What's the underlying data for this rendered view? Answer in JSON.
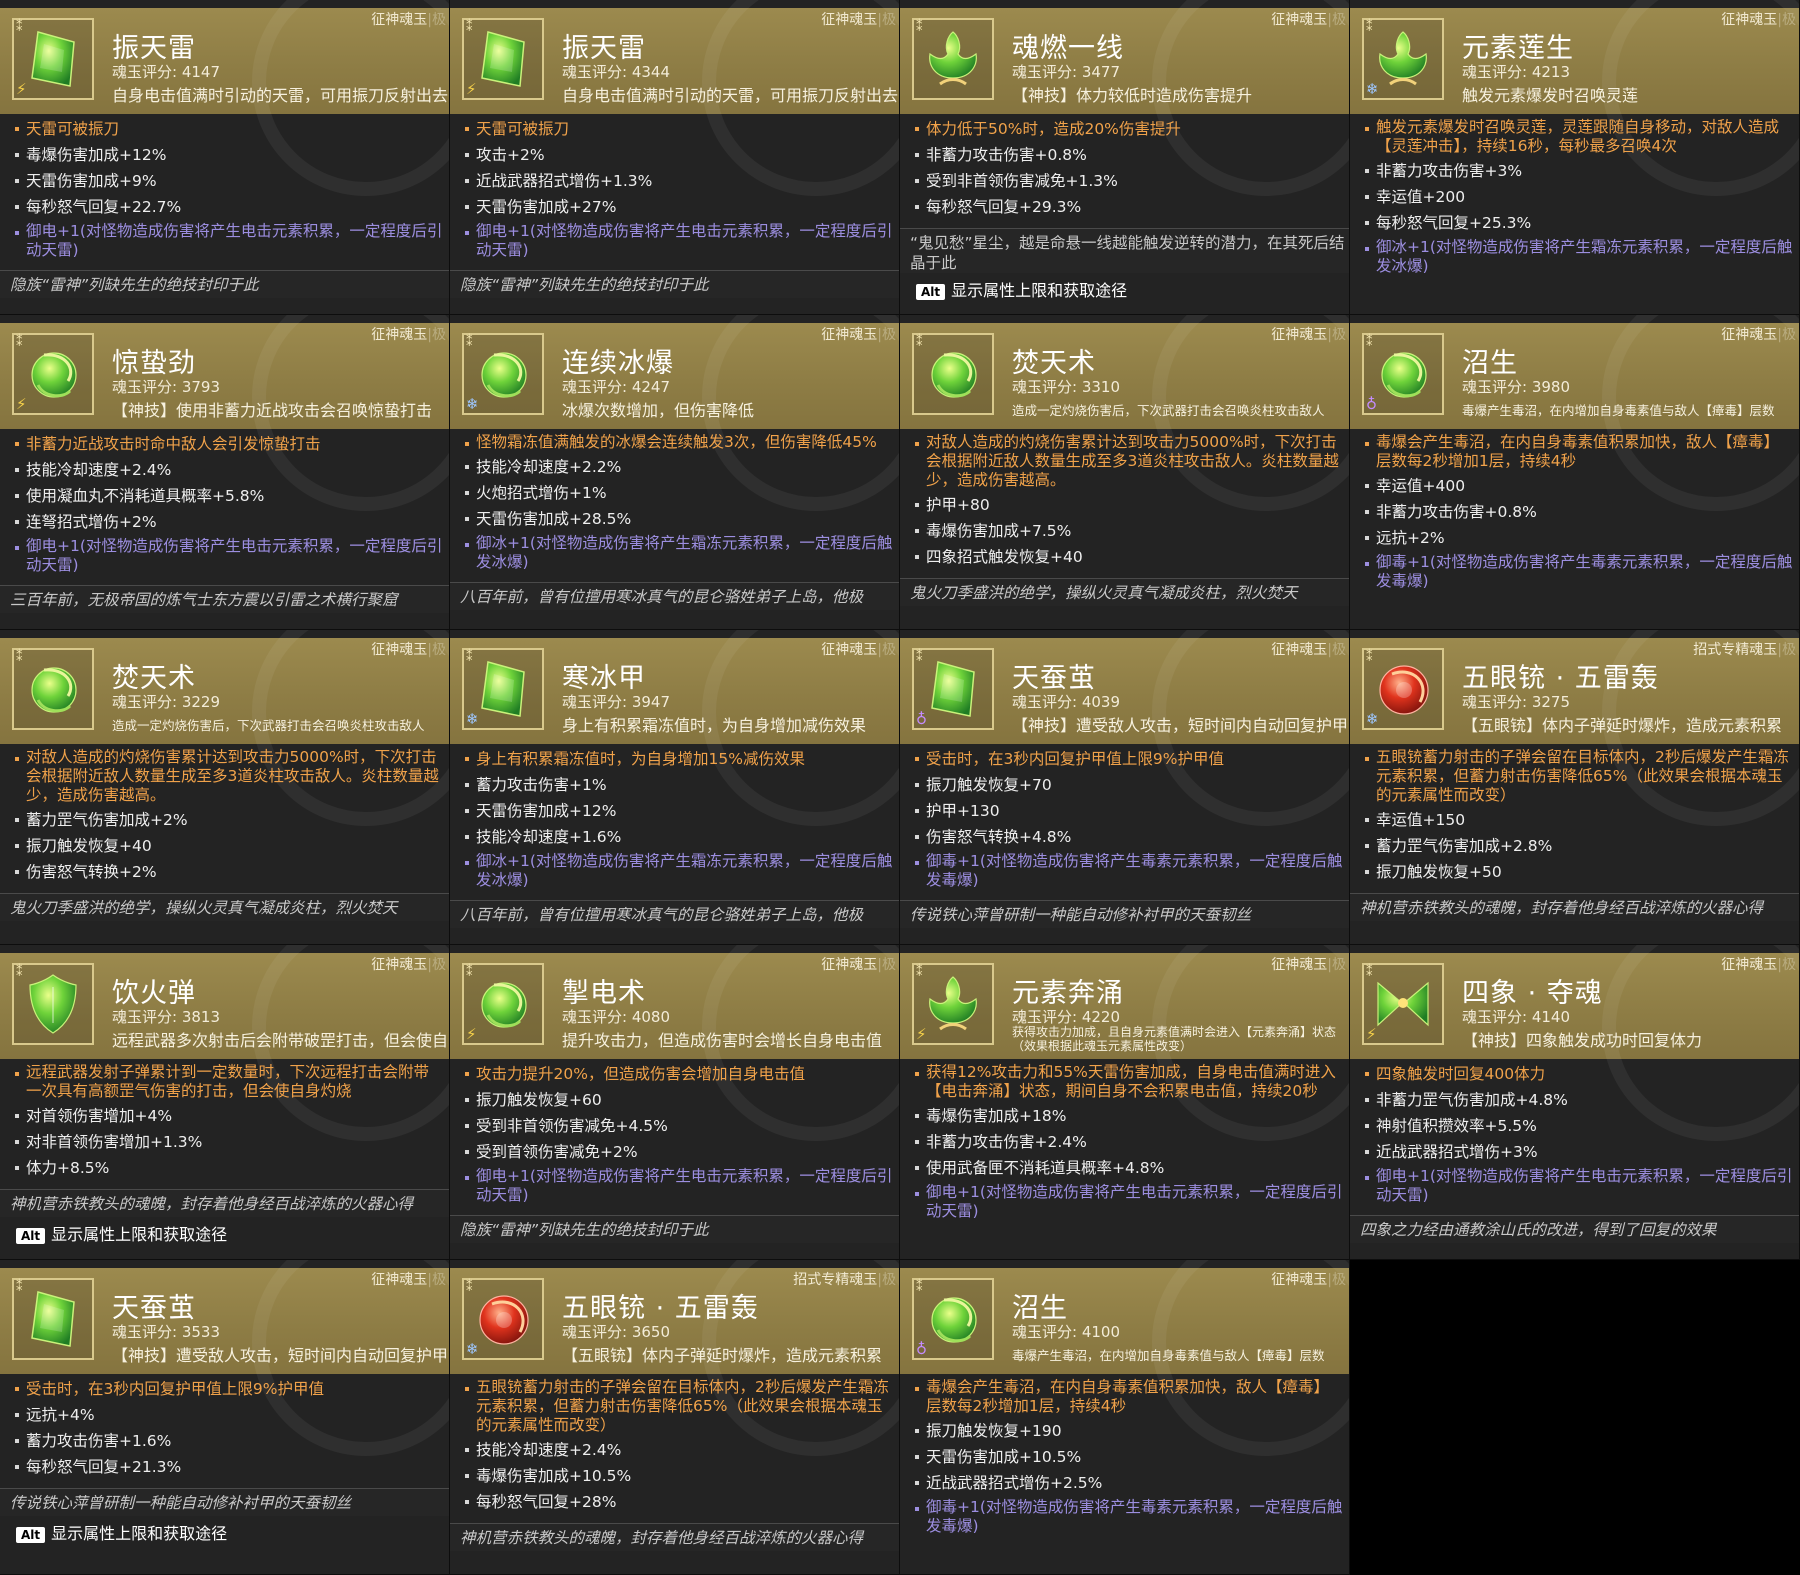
{
  "cards": [
    {
      "title": "振天雷",
      "tag": "征神魂玉",
      "grade": "极",
      "score": "魂玉评分: 4147",
      "desc": "自身电击值满时引动的天雷，可用振刀反射出去",
      "icon": "green-jade-icon",
      "element": "lightning-icon",
      "main": "天雷可被振刀",
      "attrs": [
        "毒爆伤害加成+12%",
        "天雷伤害加成+9%",
        "每秒怒气回复+22.7%"
      ],
      "elem": "御电+1(对怪物造成伤害将产生电击元素积累，一定程度后引动天雷)",
      "flavor": "隐族“雷神”列缺先生的绝技封印于此"
    },
    {
      "title": "振天雷",
      "tag": "征神魂玉",
      "grade": "极",
      "score": "魂玉评分: 4344",
      "desc": "自身电击值满时引动的天雷，可用振刀反射出去",
      "icon": "green-jade-icon",
      "element": "lightning-icon",
      "main": "天雷可被振刀",
      "attrs": [
        "攻击+2%",
        "近战武器招式增伤+1.3%",
        "天雷伤害加成+27%"
      ],
      "elem": "御电+1(对怪物造成伤害将产生电击元素积累，一定程度后引动天雷)",
      "flavor": "隐族“雷神”列缺先生的绝技封印于此"
    },
    {
      "title": "魂燃一线",
      "tag": "征神魂玉",
      "grade": "极",
      "score": "魂玉评分: 3477",
      "desc": "【神技】体力较低时造成伤害提升",
      "icon": "lotus-jade-icon",
      "element": "",
      "main": "体力低于50%时，造成20%伤害提升",
      "attrs": [
        "非蓄力攻击伤害+0.8%",
        "受到非首领伤害减免+1.3%",
        "每秒怒气回复+29.3%"
      ],
      "elem": "",
      "flavor": "“鬼见愁”星尘，越是命悬一线越能触发逆转的潜力，在其死后结晶于此",
      "alt": "显示属性上限和获取途径"
    },
    {
      "title": "元素莲生",
      "tag": "征神魂玉",
      "grade": "极",
      "score": "魂玉评分: 4213",
      "desc": "触发元素爆发时召唤灵莲",
      "icon": "lotus-jade-icon",
      "element": "frost-icon",
      "main": "触发元素爆发时召唤灵莲，灵莲跟随自身移动，对敌人造成【灵莲冲击】，持续16秒，每秒最多召唤4次",
      "attrs": [
        "非蓄力攻击伤害+3%",
        "幸运值+200",
        "每秒怒气回复+25.3%"
      ],
      "elem": "御冰+1(对怪物造成伤害将产生霜冻元素积累，一定程度后触发冰爆)",
      "flavor": ""
    },
    {
      "title": "惊蛰劲",
      "tag": "征神魂玉",
      "grade": "极",
      "score": "魂玉评分: 3793",
      "desc": "【神技】使用非蓄力近战攻击会召唤惊蛰打击",
      "icon": "orb-jade-icon",
      "element": "lightning-icon",
      "main": "非蓄力近战攻击时命中敌人会引发惊蛰打击",
      "attrs": [
        "技能冷却速度+2.4%",
        "使用凝血丸不消耗道具概率+5.8%",
        "连弩招式增伤+2%"
      ],
      "elem": "御电+1(对怪物造成伤害将产生电击元素积累，一定程度后引动天雷)",
      "flavor": "三百年前，无极帝国的炼气士东方震以引雷之术横行聚窟"
    },
    {
      "title": "连续冰爆",
      "tag": "征神魂玉",
      "grade": "极",
      "score": "魂玉评分: 4247",
      "desc": "冰爆次数增加，但伤害降低",
      "icon": "orb-jade-icon",
      "element": "frost-icon",
      "main": "怪物霜冻值满触发的冰爆会连续触发3次，但伤害降低45%",
      "attrs": [
        "技能冷却速度+2.2%",
        "火炮招式增伤+1%",
        "天雷伤害加成+28.5%"
      ],
      "elem": "御冰+1(对怪物造成伤害将产生霜冻元素积累，一定程度后触发冰爆)",
      "flavor": "八百年前，曾有位擅用寒冰真气的昆仑骆姓弟子上岛，他极"
    },
    {
      "title": "焚天术",
      "tag": "征神魂玉",
      "grade": "极",
      "score": "魂玉评分: 3310",
      "desc": "造成一定灼烧伤害后，下次武器打击会召唤炎柱攻击敌人",
      "icon": "orb-jade-icon",
      "element": "",
      "main": "对敌人造成的灼烧伤害累计达到攻击力5000%时，下次打击会根据附近敌人数量生成至多3道炎柱攻击敌人。炎柱数量越少，造成伤害越高。",
      "attrs": [
        "护甲+80",
        "毒爆伤害加成+7.5%",
        "四象招式触发恢复+40"
      ],
      "elem": "",
      "flavor": "鬼火刀季盛洪的绝学，操纵火灵真气凝成炎柱，烈火焚天"
    },
    {
      "title": "沼生",
      "tag": "征神魂玉",
      "grade": "极",
      "score": "魂玉评分: 3980",
      "desc": "毒爆产生毒沼，在内增加自身毒素值与敌人【瘴毒】层数",
      "icon": "orb-jade-icon",
      "element": "poison-icon",
      "main": "毒爆会产生毒沼，在内自身毒素值积累加快，敌人【瘴毒】层数每2秒增加1层，持续4秒",
      "attrs": [
        "幸运值+400",
        "非蓄力攻击伤害+0.8%",
        "远抗+2%"
      ],
      "elem": "御毒+1(对怪物造成伤害将产生毒素元素积累，一定程度后触发毒爆)",
      "flavor": ""
    },
    {
      "title": "焚天术",
      "tag": "征神魂玉",
      "grade": "极",
      "score": "魂玉评分: 3229",
      "desc": "造成一定灼烧伤害后，下次武器打击会召唤炎柱攻击敌人",
      "icon": "orb-jade-icon",
      "element": "",
      "main": "对敌人造成的灼烧伤害累计达到攻击力5000%时，下次打击会根据附近敌人数量生成至多3道炎柱攻击敌人。炎柱数量越少，造成伤害越高。",
      "attrs": [
        "蓄力罡气伤害加成+2%",
        "振刀触发恢复+40",
        "伤害怒气转换+2%"
      ],
      "elem": "",
      "flavor": "鬼火刀季盛洪的绝学，操纵火灵真气凝成炎柱，烈火焚天"
    },
    {
      "title": "寒冰甲",
      "tag": "征神魂玉",
      "grade": "极",
      "score": "魂玉评分: 3947",
      "desc": "身上有积累霜冻值时，为自身增加减伤效果",
      "icon": "green-jade-icon",
      "element": "frost-icon",
      "main": "身上有积累霜冻值时，为自身增加15%减伤效果",
      "attrs": [
        "蓄力攻击伤害+1%",
        "天雷伤害加成+12%",
        "技能冷却速度+1.6%"
      ],
      "elem": "御冰+1(对怪物造成伤害将产生霜冻元素积累，一定程度后触发冰爆)",
      "flavor": "八百年前，曾有位擅用寒冰真气的昆仑骆姓弟子上岛，他极"
    },
    {
      "title": "天蚕茧",
      "tag": "征神魂玉",
      "grade": "极",
      "score": "魂玉评分: 4039",
      "desc": "【神技】遭受敌人攻击，短时间内自动回复护甲值",
      "icon": "green-jade-icon",
      "element": "poison-icon",
      "main": "受击时，在3秒内回复护甲值上限9%护甲值",
      "attrs": [
        "振刀触发恢复+70",
        "护甲+130",
        "伤害怒气转换+4.8%"
      ],
      "elem": "御毒+1(对怪物造成伤害将产生毒素元素积累，一定程度后触发毒爆)",
      "flavor": "传说铁心萍曾研制一种能自动修补衬甲的天蚕韧丝"
    },
    {
      "title": "五眼铳 · 五雷轰",
      "tag": "招式专精魂玉",
      "grade": "极",
      "score": "魂玉评分: 3275",
      "desc": "【五眼铳】体内子弹延时爆炸，造成元素积累",
      "icon": "red-jade-icon",
      "element": "frost-icon",
      "main": "五眼铳蓄力射击的子弹会留在目标体内，2秒后爆发产生霜冻元素积累，但蓄力射击伤害降低65%（此效果会根据本魂玉的元素属性而改变）",
      "attrs": [
        "幸运值+150",
        "蓄力罡气伤害加成+2.8%",
        "振刀触发恢复+50"
      ],
      "elem": "",
      "flavor": "神机营赤铁教头的魂魄，封存着他身经百战淬炼的火器心得"
    },
    {
      "title": "饮火弹",
      "tag": "征神魂玉",
      "grade": "极",
      "score": "魂玉评分: 3813",
      "desc": "远程武器多次射击后会附带破罡打击，但会使自身灼烧",
      "icon": "shield-jade-icon",
      "element": "",
      "main": "远程武器发射子弹累计到一定数量时，下次远程打击会附带一次具有高额罡气伤害的打击，但会使自身灼烧",
      "attrs": [
        "对首领伤害增加+4%",
        "对非首领伤害增加+1.3%",
        "体力+8.5%"
      ],
      "elem": "",
      "flavor": "神机营赤铁教头的魂魄，封存着他身经百战淬炼的火器心得",
      "alt": "显示属性上限和获取途径"
    },
    {
      "title": "掣电术",
      "tag": "征神魂玉",
      "grade": "极",
      "score": "魂玉评分: 4080",
      "desc": "提升攻击力，但造成伤害时会增长自身电击值",
      "icon": "orb-jade-icon",
      "element": "lightning-icon",
      "main": "攻击力提升20%，但造成伤害会增加自身电击值",
      "attrs": [
        "振刀触发恢复+60",
        "受到非首领伤害减免+4.5%",
        "受到首领伤害减免+2%"
      ],
      "elem": "御电+1(对怪物造成伤害将产生电击元素积累，一定程度后引动天雷)",
      "flavor": "隐族“雷神”列缺先生的绝技封印于此"
    },
    {
      "title": "元素奔涌",
      "tag": "征神魂玉",
      "grade": "极",
      "score": "魂玉评分: 4220",
      "desc": "获得攻击力加成，且自身元素值满时会进入【元素奔涌】状态（效果根据此魂玉元素属性改变）",
      "icon": "lotus-jade-icon",
      "element": "lightning-icon",
      "main": "获得12%攻击力和55%天雷伤害加成，自身电击值满时进入【电击奔涌】状态，期间自身不会积累电击值，持续20秒",
      "attrs": [
        "毒爆伤害加成+18%",
        "非蓄力攻击伤害+2.4%",
        "使用武备匣不消耗道具概率+4.8%"
      ],
      "elem": "御电+1(对怪物造成伤害将产生电击元素积累，一定程度后引动天雷)",
      "flavor": ""
    },
    {
      "title": "四象 · 夺魂",
      "tag": "征神魂玉",
      "grade": "极",
      "score": "魂玉评分: 4140",
      "desc": "【神技】四象触发成功时回复体力",
      "icon": "butterfly-jade-icon",
      "element": "lightning-icon",
      "main": "四象触发时回复400体力",
      "attrs": [
        "非蓄力罡气伤害加成+4.8%",
        "神射值积攒效率+5.5%",
        "近战武器招式增伤+3%"
      ],
      "elem": "御电+1(对怪物造成伤害将产生电击元素积累，一定程度后引动天雷)",
      "flavor": "四象之力经由通教涂山氏的改进，得到了回复的效果"
    },
    {
      "title": "天蚕茧",
      "tag": "征神魂玉",
      "grade": "极",
      "score": "魂玉评分: 3533",
      "desc": "【神技】遭受敌人攻击，短时间内自动回复护甲值",
      "icon": "green-jade-icon",
      "element": "",
      "main": "受击时，在3秒内回复护甲值上限9%护甲值",
      "attrs": [
        "远抗+4%",
        "蓄力攻击伤害+1.6%",
        "每秒怒气回复+21.3%"
      ],
      "elem": "",
      "flavor": "传说铁心萍曾研制一种能自动修补衬甲的天蚕韧丝",
      "alt": "显示属性上限和获取途径"
    },
    {
      "title": "五眼铳 · 五雷轰",
      "tag": "招式专精魂玉",
      "grade": "极",
      "score": "魂玉评分: 3650",
      "desc": "【五眼铳】体内子弹延时爆炸，造成元素积累",
      "icon": "red-jade-icon",
      "element": "frost-icon",
      "main": "五眼铳蓄力射击的子弹会留在目标体内，2秒后爆发产生霜冻元素积累，但蓄力射击伤害降低65%（此效果会根据本魂玉的元素属性而改变）",
      "attrs": [
        "技能冷却速度+2.4%",
        "毒爆伤害加成+10.5%",
        "每秒怒气回复+28%"
      ],
      "elem": "",
      "flavor": "神机营赤铁教头的魂魄，封存着他身经百战淬炼的火器心得"
    },
    {
      "title": "沼生",
      "tag": "征神魂玉",
      "grade": "极",
      "score": "魂玉评分: 4100",
      "desc": "毒爆产生毒沼，在内增加自身毒素值与敌人【瘴毒】层数",
      "icon": "orb-jade-icon",
      "element": "poison-icon",
      "main": "毒爆会产生毒沼，在内自身毒素值积累加快，敌人【瘴毒】层数每2秒增加1层，持续4秒",
      "attrs": [
        "振刀触发恢复+190",
        "天雷伤害加成+10.5%",
        "近战武器招式增伤+2.5%"
      ],
      "elem": "御毒+1(对怪物造成伤害将产生毒素元素积累，一定程度后触发毒爆)",
      "flavor": ""
    }
  ],
  "alt_key": "Alt",
  "colors": {
    "header": "#8e7d45",
    "body": "#232323",
    "main_attr": "#f0a24a",
    "element_attr": "#9c8ee0"
  }
}
